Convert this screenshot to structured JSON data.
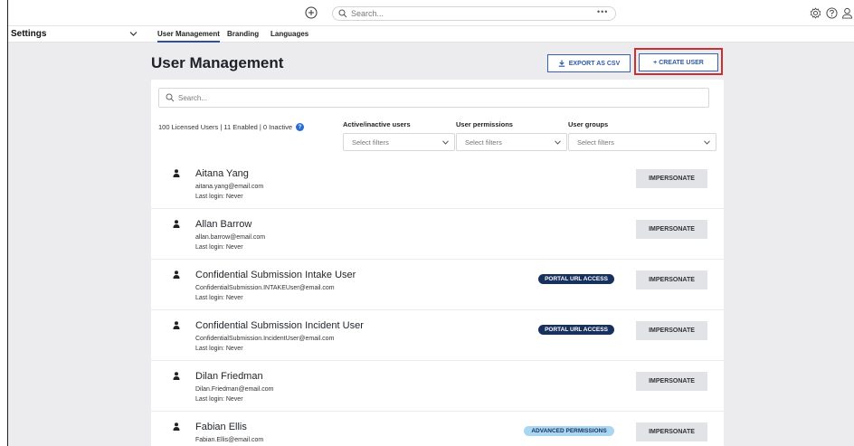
{
  "topbar": {
    "search_placeholder": "Search...",
    "more_label": "•••"
  },
  "subnav": {
    "section": "Settings",
    "tabs": [
      {
        "label": "User Management",
        "active": true
      },
      {
        "label": "Branding",
        "active": false
      },
      {
        "label": "Languages",
        "active": false
      }
    ]
  },
  "header": {
    "title": "User Management",
    "export_label": "EXPORT AS CSV",
    "create_label": "+ CREATE USER"
  },
  "panel": {
    "search_placeholder": "Search...",
    "counts": "100 Licensed Users | 11 Enabled | 0 Inactive",
    "info_glyph": "?",
    "filters": [
      {
        "label": "Active/inactive users",
        "placeholder": "Select filters"
      },
      {
        "label": "User permissions",
        "placeholder": "Select filters"
      },
      {
        "label": "User groups",
        "placeholder": "Select filters"
      }
    ]
  },
  "users": [
    {
      "name": "Aitana Yang",
      "email": "aitana.yang@email.com",
      "last_login": "Last login: Never",
      "badge": "",
      "action": "IMPERSONATE"
    },
    {
      "name": "Allan Barrow",
      "email": "allan.barrow@email.com",
      "last_login": "Last login: Never",
      "badge": "",
      "action": "IMPERSONATE"
    },
    {
      "name": "Confidential Submission Intake User",
      "email": "ConfidentialSubmission.INTAKEUser@email.com",
      "last_login": "Last login: Never",
      "badge": "PORTAL URL ACCESS",
      "badge_style": "dark",
      "action": "IMPERSONATE"
    },
    {
      "name": "Confidential Submission Incident User",
      "email": "ConfidentialSubmission.IncidentUser@email.com",
      "last_login": "Last login: Never",
      "badge": "PORTAL URL ACCESS",
      "badge_style": "dark",
      "action": "IMPERSONATE"
    },
    {
      "name": "Dilan Friedman",
      "email": "Dilan.Friedman@email.com",
      "last_login": "Last login: Never",
      "badge": "",
      "action": "IMPERSONATE"
    },
    {
      "name": "Fabian Ellis",
      "email": "Fabian.Ellis@email.com",
      "last_login": "",
      "badge": "ADVANCED PERMISSIONS",
      "badge_style": "light",
      "action": "IMPERSONATE"
    }
  ],
  "colors": {
    "accent": "#2f5aa8",
    "highlight": "#cc2f32",
    "badge_dark": "#17315e",
    "badge_light": "#a9d7f1"
  }
}
